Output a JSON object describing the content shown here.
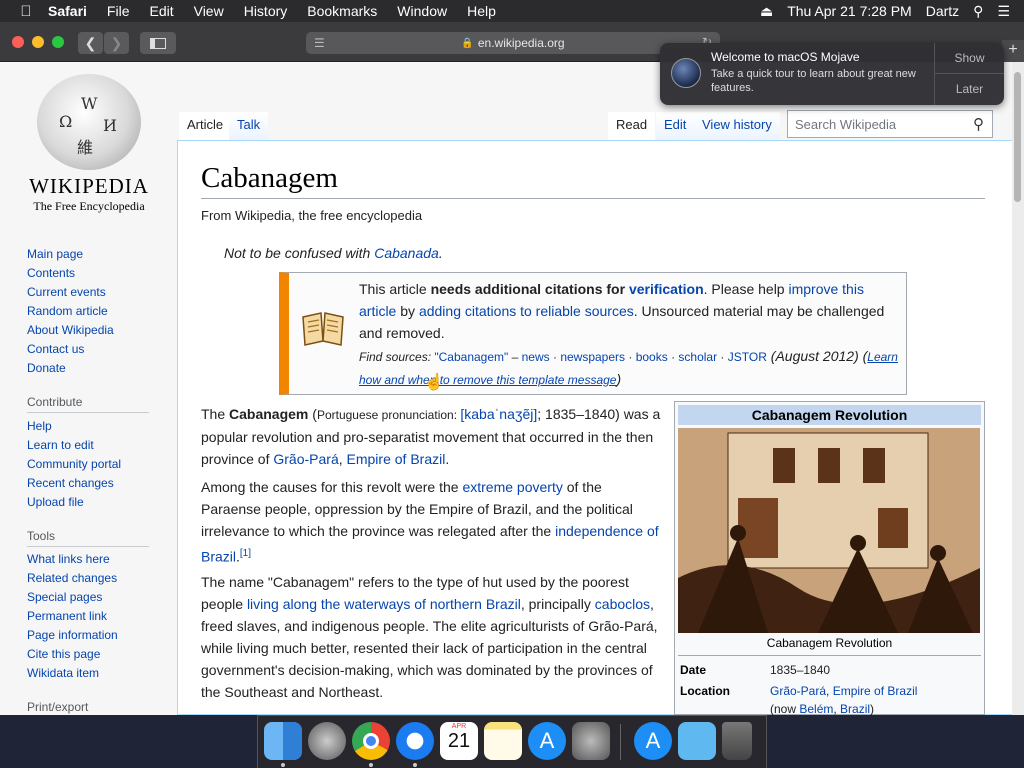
{
  "menubar": {
    "apple": "",
    "app": "Safari",
    "items": [
      "File",
      "Edit",
      "View",
      "History",
      "Bookmarks",
      "Window",
      "Help"
    ],
    "datetime": "Thu Apr 21  7:28 PM",
    "user": "Dartz"
  },
  "toolbar": {
    "url": "en.wikipedia.org",
    "newtab": "+"
  },
  "notification": {
    "title": "Welcome to macOS Mojave",
    "body": "Take a quick tour to learn about great new features.",
    "show": "Show",
    "later": "Later"
  },
  "logo": {
    "wordmark": "WIKIPEDIA",
    "tagline": "The Free Encyclopedia"
  },
  "sidebar": {
    "nav": [
      "Main page",
      "Contents",
      "Current events",
      "Random article",
      "About Wikipedia",
      "Contact us",
      "Donate"
    ],
    "contribute_head": "Contribute",
    "contribute": [
      "Help",
      "Learn to edit",
      "Community portal",
      "Recent changes",
      "Upload file"
    ],
    "tools_head": "Tools",
    "tools": [
      "What links here",
      "Related changes",
      "Special pages",
      "Permanent link",
      "Page information",
      "Cite this page",
      "Wikidata item"
    ],
    "print_head": "Print/export"
  },
  "tabs": {
    "article": "Article",
    "talk": "Talk",
    "read": "Read",
    "edit": "Edit",
    "history": "View history"
  },
  "search": {
    "placeholder": "Search Wikipedia"
  },
  "article": {
    "title": "Cabanagem",
    "from": "From Wikipedia, the free encyclopedia",
    "notconf_pre": "Not to be confused with ",
    "notconf_link": "Cabanada",
    "notconf_post": "."
  },
  "ambox": {
    "t1": "This article ",
    "t2": "needs additional citations for ",
    "t3": "verification",
    "t4": ". Please help ",
    "t5": "improve this article",
    "t6": " by ",
    "t7": "adding citations to reliable sources",
    "t8": ". Unsourced material may be challenged and removed.",
    "find": "Find sources: ",
    "q": "\"Cabanagem\"",
    "dash": " – ",
    "news": "news",
    "papers": "newspapers",
    "books": "books",
    "scholar": "scholar",
    "jstor": "JSTOR",
    "date": " (August 2012) (",
    "learn": "Learn how and when to remove this template message",
    "close": ")"
  },
  "paragraphs": {
    "p1a": "The ",
    "p1b": "Cabanagem",
    "p1c": " (",
    "p1d": "Portuguese pronunciation: ",
    "p1e": "[kabaˈnaʒẽj]",
    "p1f": "; 1835–1840) was a popular revolution and pro-separatist movement that occurred in the then province of ",
    "p1g": "Grão-Pará",
    "p1h": ", ",
    "p1i": "Empire of Brazil",
    "p1j": ".",
    "p2a": "Among the causes for this revolt were the ",
    "p2b": "extreme poverty",
    "p2c": " of the Paraense people, oppression by the Empire of Brazil, and the political irrelevance to which the province was relegated after the ",
    "p2d": "independence of Brazil",
    "p2e": ".",
    "p2f": "[1]",
    "p3a": "The name \"Cabanagem\" refers to the type of hut used by the poorest people ",
    "p3b": "living along the waterways of northern Brazil",
    "p3c": ", principally ",
    "p3d": "caboclos",
    "p3e": ", freed slaves, and indigenous people. The elite agriculturists of Grão-Pará, while living much better, resented their lack of participation in the central government's decision-making, which was dominated by the provinces of the Southeast and Northeast."
  },
  "infobox": {
    "title": "Cabanagem Revolution",
    "caption": "Cabanagem Revolution",
    "date_k": "Date",
    "date_v": "1835–1840",
    "loc_k": "Location",
    "loc_v1": "Grão-Pará",
    "loc_v2": ", ",
    "loc_v3": "Empire of Brazil",
    "loc_v4": "(now ",
    "loc_v5": "Belém",
    "loc_v6": ", ",
    "loc_v7": "Brazil",
    "loc_v8": ")"
  },
  "dock": {
    "calendar_month": "APR",
    "calendar_day": "21"
  },
  "colors": {
    "link": "#0645ad",
    "ambox_stripe": "#f28500",
    "infobox_header": "#c3d6ef"
  }
}
